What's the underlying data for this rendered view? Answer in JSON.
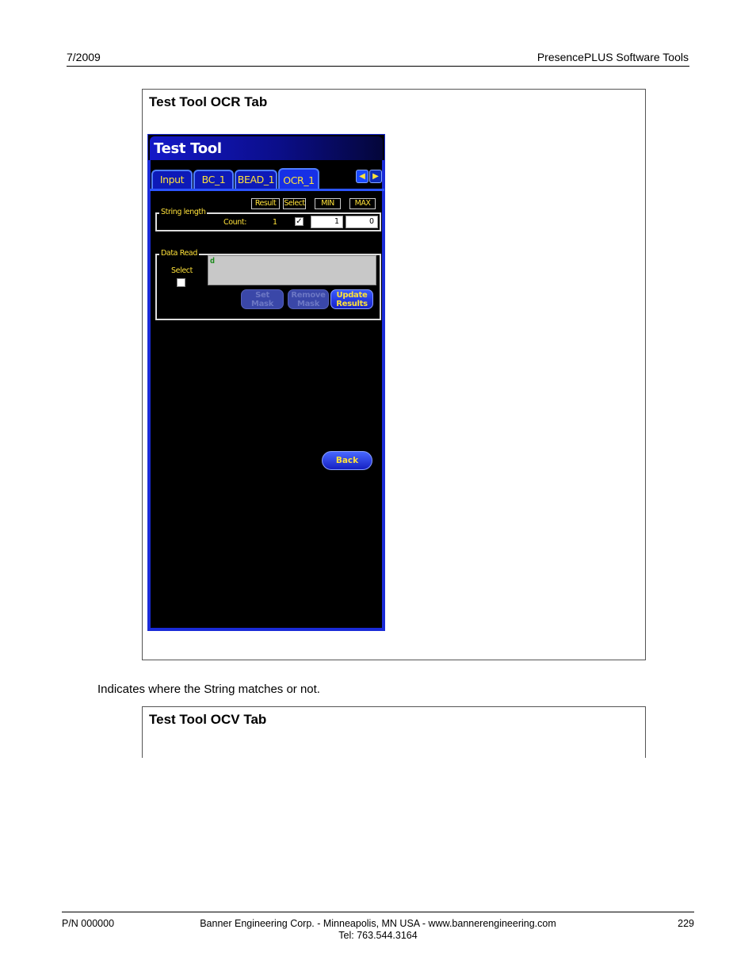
{
  "header": {
    "date": "7/2009",
    "title": "PresencePLUS Software Tools"
  },
  "figure1": {
    "title": "Test Tool OCR Tab",
    "app": {
      "window_title": "Test Tool",
      "tabs": [
        {
          "label": "Input",
          "active": false
        },
        {
          "label": "BC_1",
          "active": false
        },
        {
          "label": "BEAD_1",
          "active": false
        },
        {
          "label": "OCR_1",
          "active": true
        }
      ],
      "string_length": {
        "legend": "String length",
        "columns": {
          "result": "Result",
          "select": "Select",
          "min": "MIN",
          "max": "MAX"
        },
        "count_label": "Count:",
        "count_value": "1",
        "selected": true,
        "min_value": "1",
        "max_value": "0"
      },
      "data_read": {
        "legend": "Data Read",
        "select_label": "Select",
        "selected": false,
        "value": "d",
        "buttons": {
          "set_mask_1": "Set",
          "set_mask_2": "Mask",
          "remove_mask_1": "Remove",
          "remove_mask_2": "Mask",
          "update_results_1": "Update",
          "update_results_2": "Results"
        }
      },
      "back_label": "Back"
    }
  },
  "caption": "Indicates where the String matches or not.",
  "figure2": {
    "title": "Test Tool OCV Tab"
  },
  "footer": {
    "part_number": "P/N 000000",
    "company": "Banner Engineering Corp. - Minneapolis, MN USA - www.bannerengineering.com",
    "phone": "Tel: 763.544.3164",
    "page": "229"
  },
  "colors": {
    "panel_blue": "#1a2bd8",
    "label_yellow": "#ffe23a",
    "background_black": "#000000"
  }
}
